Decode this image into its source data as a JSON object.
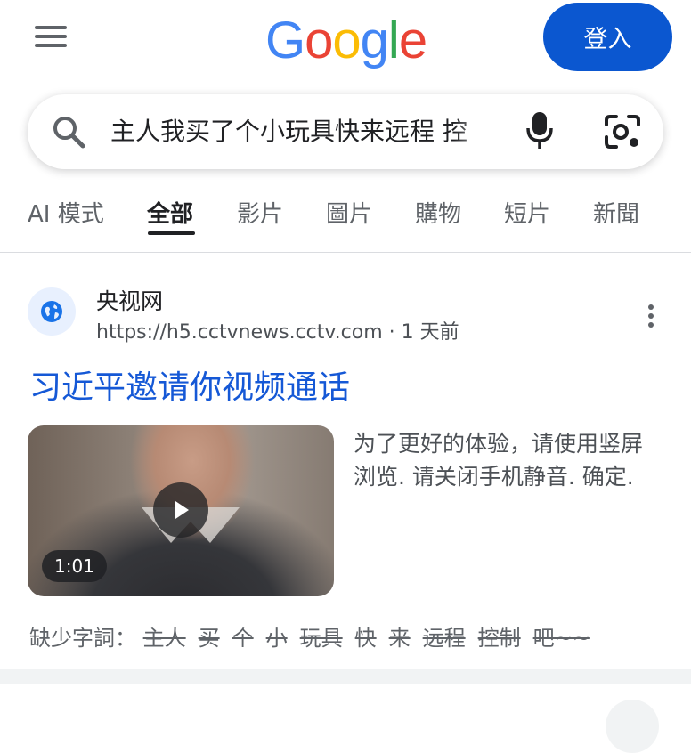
{
  "header": {
    "logo": {
      "letters": [
        "G",
        "o",
        "o",
        "g",
        "l",
        "e"
      ],
      "colors": [
        "#4285f4",
        "#ea4335",
        "#fbbc05",
        "#4285f4",
        "#34a853",
        "#ea4335"
      ]
    },
    "signin_label": "登入",
    "accent": "#0b57d0"
  },
  "search": {
    "query": "主人我买了个小玩具快来远程 控",
    "icons": {
      "search": "search-icon",
      "voice": "microphone-icon",
      "lens": "camera-lens-icon"
    }
  },
  "tabs": [
    {
      "label": "AI 模式",
      "active": false
    },
    {
      "label": "全部",
      "active": true
    },
    {
      "label": "影片",
      "active": false
    },
    {
      "label": "圖片",
      "active": false
    },
    {
      "label": "購物",
      "active": false
    },
    {
      "label": "短片",
      "active": false
    },
    {
      "label": "新聞",
      "active": false
    }
  ],
  "result": {
    "site_name": "央视网",
    "url": "https://h5.cctvnews.cctv.com",
    "age": "1 天前",
    "title": "习近平邀请你视频通话",
    "duration": "1:01",
    "snippet": "为了更好的体验，请使用竖屏浏览. 请关闭手机静音. 确定.",
    "missing_label": "缺少字詞：",
    "missing_words": [
      "主人",
      "买",
      "个",
      "小",
      "玩具",
      "快",
      "来",
      "远程",
      "控制",
      "吧~~"
    ],
    "link_color": "#1558d6"
  }
}
